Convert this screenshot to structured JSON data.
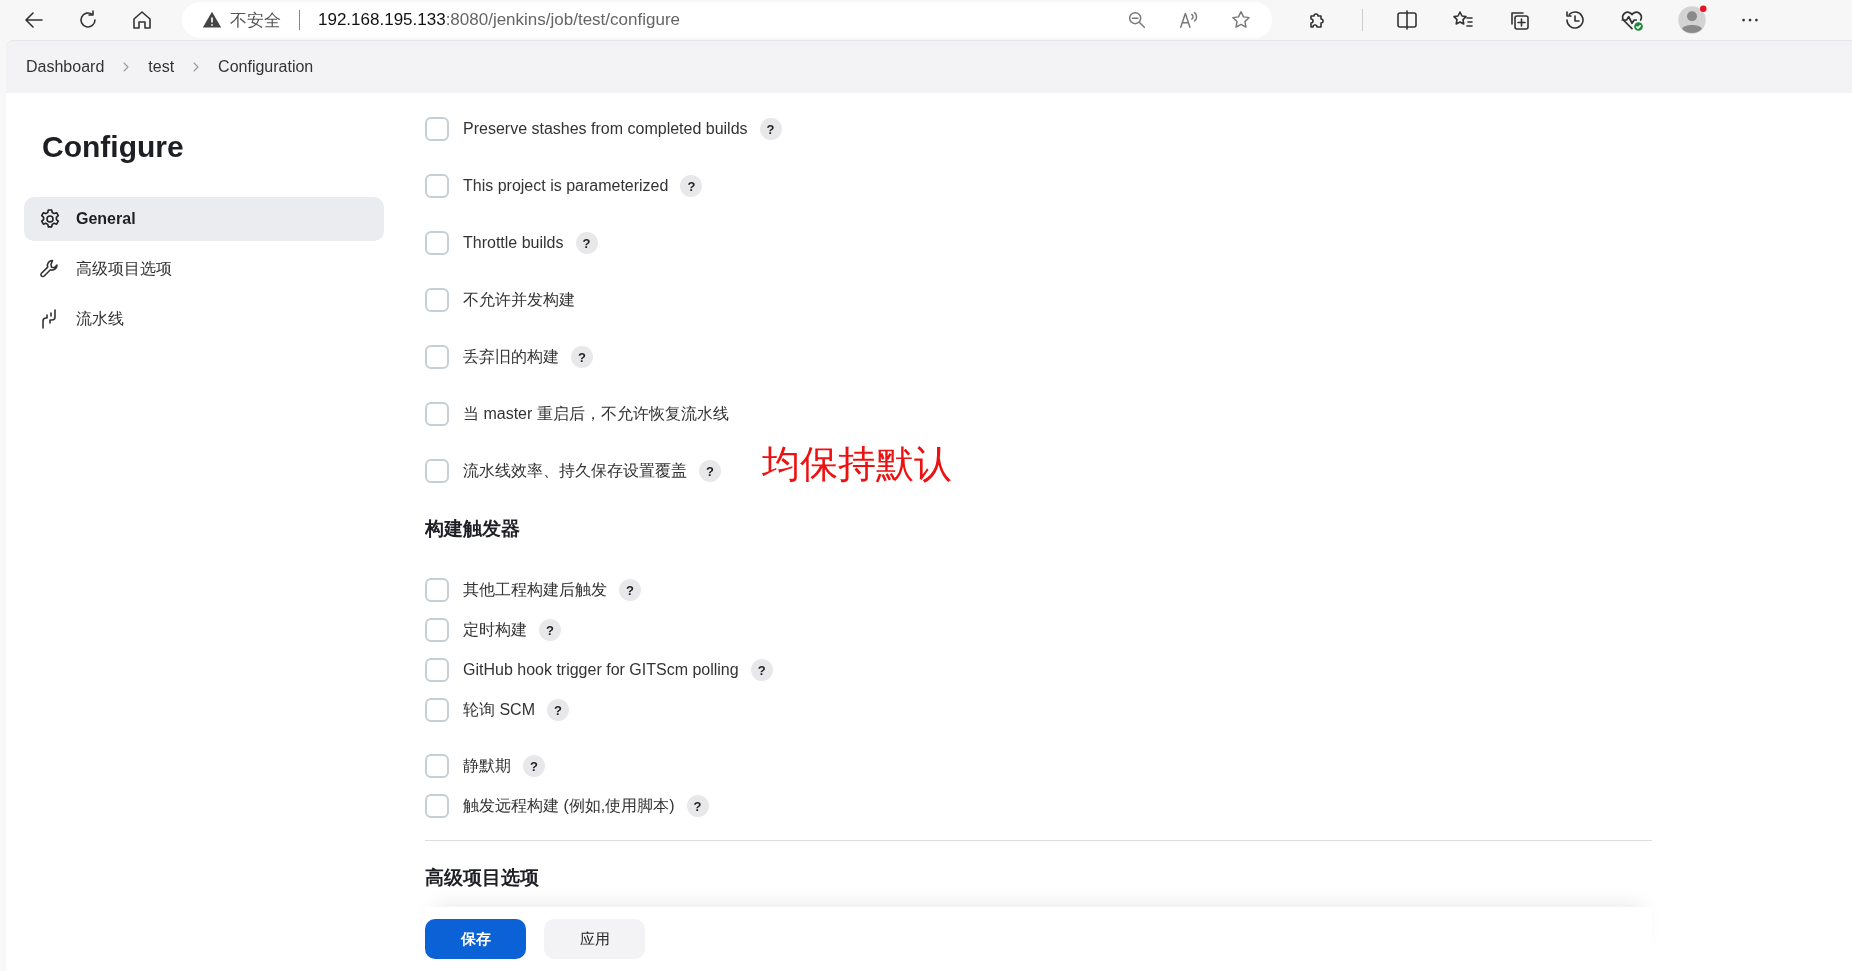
{
  "browser": {
    "security_label": "不安全",
    "url_host": "192.168.195.133",
    "url_path": ":8080/jenkins/job/test/configure"
  },
  "breadcrumbs": [
    {
      "label": "Dashboard"
    },
    {
      "label": "test"
    },
    {
      "label": "Configuration"
    }
  ],
  "sidebar": {
    "title": "Configure",
    "items": [
      {
        "label": "General",
        "kind": "gear",
        "selected": true
      },
      {
        "label": "高级项目选项",
        "kind": "wrench",
        "selected": false
      },
      {
        "label": "流水线",
        "kind": "pipeline",
        "selected": false
      }
    ]
  },
  "general_options": [
    {
      "label": "Preserve stashes from completed builds",
      "checked": false,
      "help": "?"
    },
    {
      "label": "This project is parameterized",
      "checked": false,
      "help": "?"
    },
    {
      "label": "Throttle builds",
      "checked": false,
      "help": "?"
    },
    {
      "label": "不允许并发构建",
      "checked": false
    },
    {
      "label": "丢弃旧的构建",
      "checked": false,
      "help": "?"
    },
    {
      "label": "当 master 重启后，不允许恢复流水线",
      "checked": false
    },
    {
      "label": "流水线效率、持久保存设置覆盖",
      "checked": false,
      "help": "?"
    }
  ],
  "annotation": "均保持默认",
  "triggers": {
    "heading": "构建触发器",
    "groups": [
      [
        {
          "label": "其他工程构建后触发",
          "checked": false,
          "help": "?"
        },
        {
          "label": "定时构建",
          "checked": false,
          "help": "?"
        },
        {
          "label": "GitHub hook trigger for GITScm polling",
          "checked": false,
          "help": "?"
        },
        {
          "label": "轮询 SCM",
          "checked": false,
          "help": "?"
        }
      ],
      [
        {
          "label": "静默期",
          "checked": false,
          "help": "?"
        },
        {
          "label": "触发远程构建 (例如,使用脚本)",
          "checked": false,
          "help": "?"
        }
      ]
    ]
  },
  "advanced_heading": "高级项目选项",
  "buttons": [
    {
      "label": "保存",
      "kind": "primary"
    },
    {
      "label": "应用",
      "kind": "secondary"
    }
  ]
}
